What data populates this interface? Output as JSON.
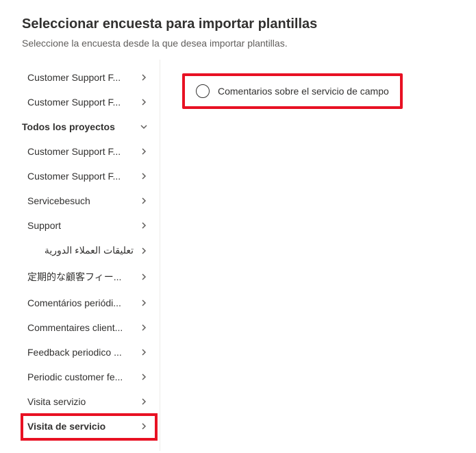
{
  "header": {
    "title": "Seleccionar encuesta para importar plantillas",
    "subtitle": "Seleccione la encuesta desde la que desea importar plantillas."
  },
  "sidebar": {
    "topItems": [
      {
        "label": "Customer Support F..."
      },
      {
        "label": "Customer Support F..."
      }
    ],
    "groupLabel": "Todos los proyectos",
    "groupItems": [
      {
        "label": "Customer Support F..."
      },
      {
        "label": "Customer Support F..."
      },
      {
        "label": "Servicebesuch"
      },
      {
        "label": "Support"
      },
      {
        "label": "تعليقات العملاء الدورية"
      },
      {
        "label": "定期的な顧客フィー..."
      },
      {
        "label": "Comentários periódi..."
      },
      {
        "label": "Commentaires client..."
      },
      {
        "label": "Feedback periodico ..."
      },
      {
        "label": "Periodic customer fe..."
      },
      {
        "label": "Visita servizio"
      },
      {
        "label": "Visita de servicio"
      }
    ]
  },
  "main": {
    "options": [
      {
        "label": "Comentarios sobre el servicio de campo"
      }
    ]
  }
}
